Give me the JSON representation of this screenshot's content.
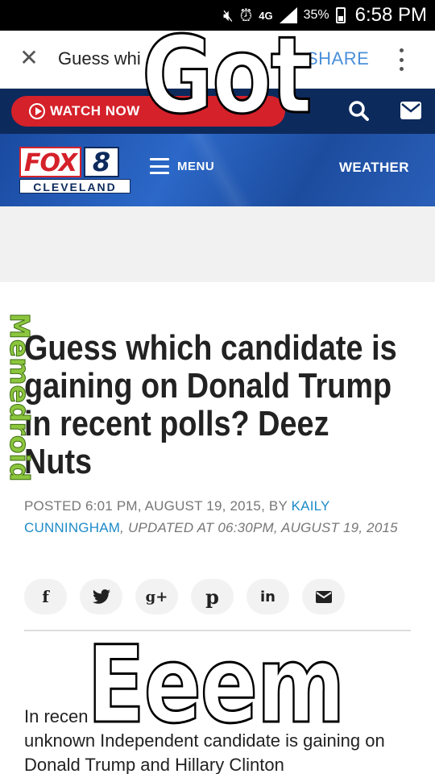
{
  "status_bar": {
    "network": "4G",
    "battery": "35%",
    "time": "6:58 PM",
    "icons": [
      "mute-icon",
      "alarm-icon",
      "signal-icon",
      "battery-icon"
    ]
  },
  "browser_bar": {
    "title": "Guess whi",
    "share_label": "SHARE",
    "icons": [
      "close-icon",
      "more-vert-icon"
    ]
  },
  "top_nav": {
    "watch_label": "WATCH NOW",
    "icons": [
      "play-icon",
      "search-icon",
      "mail-icon"
    ],
    "accent": "#d5212a",
    "background": "#0d2a5c"
  },
  "site_header": {
    "logo_fox": "FOX",
    "logo_number": "8",
    "logo_city": "CLEVELAND",
    "menu_label": "MENU",
    "weather_label": "WEATHER"
  },
  "article": {
    "headline_lines": [
      "Guess which candidate is",
      "gaining on Donald Trump",
      "in recent polls? Deez",
      "Nuts"
    ],
    "posted_prefix": "POSTED 6:01 PM, AUGUST 19, 2015, BY ",
    "author": "KAILY CUNNINGHAM",
    "updated": ", UPDATED AT 06:30PM, AUGUST 19, 2015",
    "share_buttons": [
      "f",
      "t",
      "g+",
      "p",
      "in",
      "mail"
    ],
    "body_lines": [
      "In recen",
      "unknown Independent candidate is gaining on",
      "Donald Trump and Hillary Clinton"
    ]
  },
  "meme": {
    "top_text": "Got",
    "bottom_text": "Eeem",
    "watermark": "Memedroid"
  }
}
